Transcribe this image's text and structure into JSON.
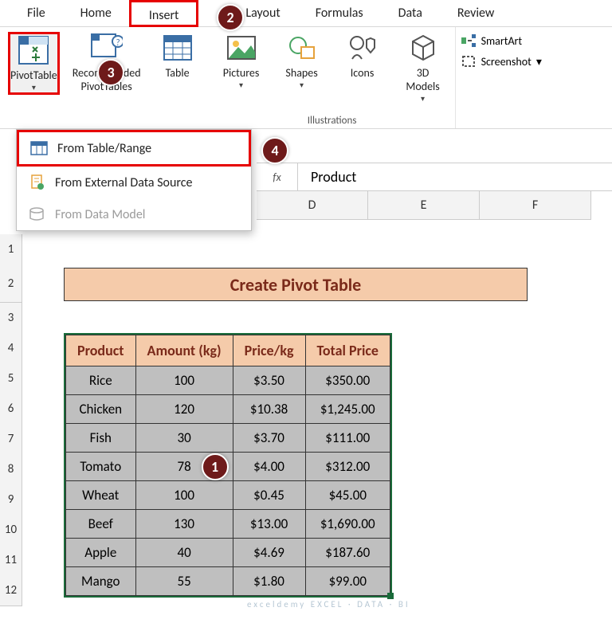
{
  "tabs": {
    "file": "File",
    "home": "Home",
    "insert": "Insert",
    "page_layout": "ge Layout",
    "formulas": "Formulas",
    "data": "Data",
    "review": "Review"
  },
  "ribbon": {
    "pivot": "PivotTable",
    "rec": "Recommended\nPivotTables",
    "table": "Table",
    "pictures": "Pictures",
    "shapes": "Shapes",
    "icons": "Icons",
    "models": "3D\nModels",
    "smartart": "SmartArt",
    "screenshot": "Screenshot",
    "illus_label": "Illustrations"
  },
  "dropdown": {
    "table_range": "From Table/Range",
    "external": "From External Data Source",
    "data_model": "From Data Model"
  },
  "fx": {
    "symbol": "fx",
    "value": "Product"
  },
  "cols": {
    "D": "D",
    "E": "E",
    "F": "F"
  },
  "rownums": [
    "1",
    "2",
    "3",
    "4",
    "5",
    "6",
    "7",
    "8",
    "9",
    "10",
    "11",
    "12"
  ],
  "sheet_title": "Create Pivot Table",
  "headers": {
    "p": "Product",
    "a": "Amount (kg)",
    "pr": "Price/kg",
    "t": "Total Price"
  },
  "rows": [
    {
      "p": "Rice",
      "a": "100",
      "pr": "$3.50",
      "t": "$350.00"
    },
    {
      "p": "Chicken",
      "a": "120",
      "pr": "$10.38",
      "t": "$1,245.00"
    },
    {
      "p": "Fish",
      "a": "30",
      "pr": "$3.70",
      "t": "$111.00"
    },
    {
      "p": "Tomato",
      "a": "78",
      "pr": "$4.00",
      "t": "$312.00"
    },
    {
      "p": "Wheat",
      "a": "100",
      "pr": "$0.45",
      "t": "$45.00"
    },
    {
      "p": "Beef",
      "a": "130",
      "pr": "$13.00",
      "t": "$1,690.00"
    },
    {
      "p": "Apple",
      "a": "40",
      "pr": "$4.69",
      "t": "$187.60"
    },
    {
      "p": "Mango",
      "a": "55",
      "pr": "$1.80",
      "t": "$99.00"
    }
  ],
  "badges": {
    "b1": "1",
    "b2": "2",
    "b3": "3",
    "b4": "4"
  },
  "watermark": "exceldemy\nEXCEL · DATA · BI"
}
